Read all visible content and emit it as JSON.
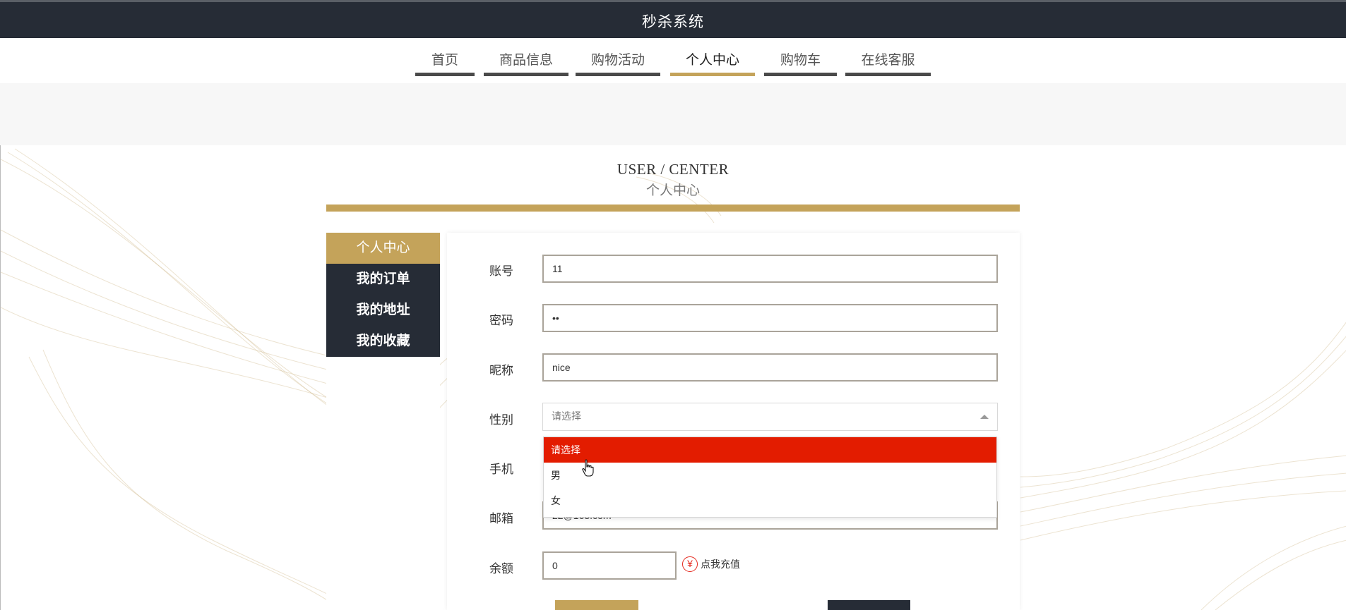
{
  "app": {
    "title": "秒杀系统"
  },
  "nav": {
    "items": [
      {
        "label": "首页",
        "active": false
      },
      {
        "label": "商品信息",
        "active": false
      },
      {
        "label": "购物活动",
        "active": false
      },
      {
        "label": "个人中心",
        "active": true
      },
      {
        "label": "购物车",
        "active": false
      },
      {
        "label": "在线客服",
        "active": false
      }
    ]
  },
  "heading": {
    "en": "USER / CENTER",
    "cn": "个人中心"
  },
  "sidebar": {
    "items": [
      {
        "label": "个人中心",
        "active": true
      },
      {
        "label": "我的订单",
        "active": false
      },
      {
        "label": "我的地址",
        "active": false
      },
      {
        "label": "我的收藏",
        "active": false
      }
    ]
  },
  "form": {
    "account": {
      "label": "账号",
      "value": "11"
    },
    "password": {
      "label": "密码",
      "value": "••"
    },
    "nickname": {
      "label": "昵称",
      "value": "nice"
    },
    "gender": {
      "label": "性别",
      "placeholder": "请选择",
      "options": [
        "请选择",
        "男",
        "女"
      ],
      "highlighted": "请选择"
    },
    "phone": {
      "label": "手机"
    },
    "email": {
      "label": "邮箱",
      "value": "22@163.com"
    },
    "balance": {
      "label": "余额",
      "value": "0"
    },
    "recharge": {
      "icon": "yen-icon",
      "label": "点我充值"
    }
  },
  "colors": {
    "accent": "#c4a35a",
    "dark": "#262c36",
    "highlight": "#e31c00"
  }
}
